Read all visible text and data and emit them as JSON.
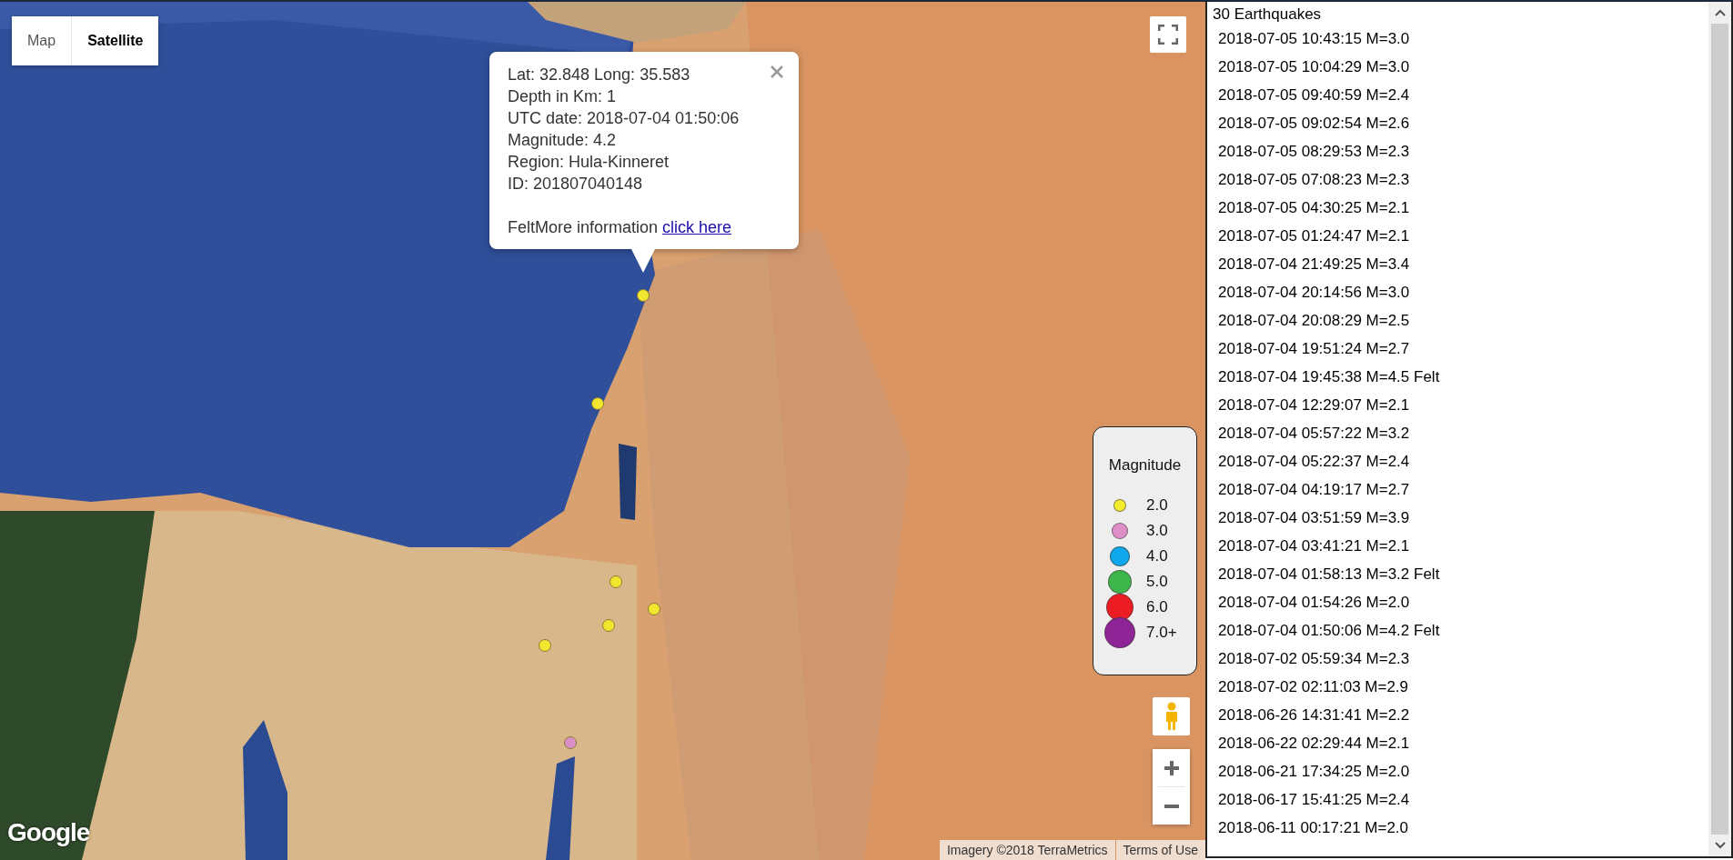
{
  "map": {
    "map_types": [
      {
        "label": "Map",
        "selected": false
      },
      {
        "label": "Satellite",
        "selected": true
      }
    ],
    "markers": [
      {
        "color": "#f2e62e"
      },
      {
        "color": "#f2e62e"
      },
      {
        "color": "#f2e62e"
      },
      {
        "color": "#f2e62e"
      },
      {
        "color": "#f2e62e"
      },
      {
        "color": "#f2e62e"
      },
      {
        "color": "#da8fc8"
      }
    ],
    "info_window": {
      "lines": [
        "Lat: 32.848 Long: 35.583",
        "Depth in Km: 1",
        "UTC date: 2018-07-04 01:50:06",
        "Magnitude: 4.2",
        "Region: Hula-Kinneret",
        "ID: 201807040148"
      ],
      "note": "FeltMore information ",
      "link": "click here"
    },
    "legend": {
      "title": "Magnitude",
      "items": [
        {
          "label": "2.0",
          "color": "#f2ec2c"
        },
        {
          "label": "3.0",
          "color": "#de8fc8"
        },
        {
          "label": "4.0",
          "color": "#10a8ec"
        },
        {
          "label": "5.0",
          "color": "#3db54a"
        },
        {
          "label": "6.0",
          "color": "#ec1c24"
        },
        {
          "label": "7.0+",
          "color": "#8e2496"
        }
      ]
    },
    "logo": "Google",
    "attribution": "Imagery ©2018 TerraMetrics",
    "terms": "Terms of Use"
  },
  "list": {
    "title": "30 Earthquakes",
    "items": [
      "2018-07-05 10:43:15 M=3.0",
      "2018-07-05 10:04:29 M=3.0",
      "2018-07-05 09:40:59 M=2.4",
      "2018-07-05 09:02:54 M=2.6",
      "2018-07-05 08:29:53 M=2.3",
      "2018-07-05 07:08:23 M=2.3",
      "2018-07-05 04:30:25 M=2.1",
      "2018-07-05 01:24:47 M=2.1",
      "2018-07-04 21:49:25 M=3.4",
      "2018-07-04 20:14:56 M=3.0",
      "2018-07-04 20:08:29 M=2.5",
      "2018-07-04 19:51:24 M=2.7",
      "2018-07-04 19:45:38 M=4.5 Felt",
      "2018-07-04 12:29:07 M=2.1",
      "2018-07-04 05:57:22 M=3.2",
      "2018-07-04 05:22:37 M=2.4",
      "2018-07-04 04:19:17 M=2.7",
      "2018-07-04 03:51:59 M=3.9",
      "2018-07-04 03:41:21 M=2.1",
      "2018-07-04 01:58:13 M=3.2 Felt",
      "2018-07-04 01:54:26 M=2.0",
      "2018-07-04 01:50:06 M=4.2 Felt",
      "2018-07-02 05:59:34 M=2.3",
      "2018-07-02 02:11:03 M=2.9",
      "2018-06-26 14:31:41 M=2.2",
      "2018-06-22 02:29:44 M=2.1",
      "2018-06-21 17:34:25 M=2.0",
      "2018-06-17 15:41:25 M=2.4",
      "2018-06-11 00:17:21 M=2.0"
    ]
  }
}
